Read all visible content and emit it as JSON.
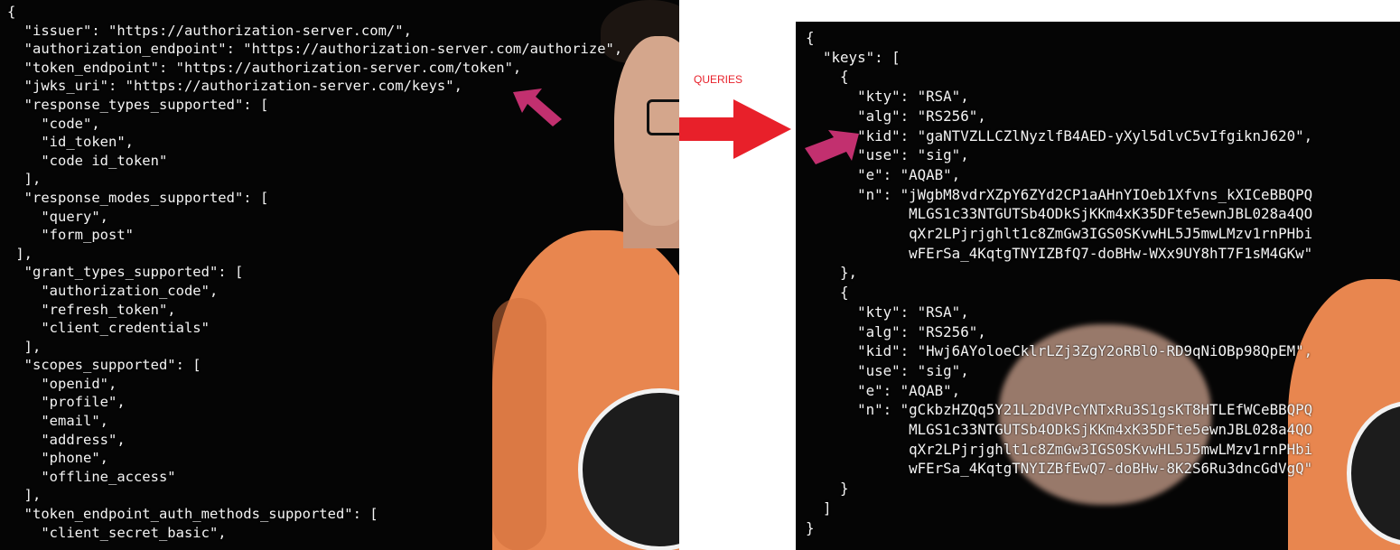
{
  "left_json": {
    "lines": [
      "{",
      "  \"issuer\": \"https://authorization-server.com/\",",
      "  \"authorization_endpoint\": \"https://authorization-server.com/authorize\",",
      "  \"token_endpoint\": \"https://authorization-server.com/token\",",
      "  \"jwks_uri\": \"https://authorization-server.com/keys\",",
      "  \"response_types_supported\": [",
      "    \"code\",",
      "    \"id_token\",",
      "    \"code id_token\"",
      "  ],",
      "  \"response_modes_supported\": [",
      "    \"query\",",
      "    \"form_post\"",
      " ],",
      "  \"grant_types_supported\": [",
      "    \"authorization_code\",",
      "    \"refresh_token\",",
      "    \"client_credentials\"",
      "  ],",
      "  \"scopes_supported\": [",
      "    \"openid\",",
      "    \"profile\",",
      "    \"email\",",
      "    \"address\",",
      "    \"phone\",",
      "    \"offline_access\"",
      "  ],",
      "  \"token_endpoint_auth_methods_supported\": [",
      "    \"client_secret_basic\","
    ]
  },
  "connector": {
    "label": "QUERIES",
    "arrow_color": "#e8202a",
    "pointer_color": "#c2306f"
  },
  "right_json": {
    "lines": [
      "{",
      "  \"keys\": [",
      "    {",
      "      \"kty\": \"RSA\",",
      "      \"alg\": \"RS256\",",
      "      \"kid\": \"gaNTVZLLCZlNyzlfB4AED-yXyl5dlvC5vIfgiknJ620\",",
      "      \"use\": \"sig\",",
      "      \"e\": \"AQAB\",",
      "      \"n\": \"jWgbM8vdrXZpY6ZYd2CP1aAHnYIOeb1Xfvns_kXICeBBQPQ",
      "            MLGS1c33NTGUTSb4ODkSjKKm4xK35DFte5ewnJBL028a4QO",
      "            qXr2LPjrjghlt1c8ZmGw3IGS0SKvwHL5J5mwLMzv1rnPHbi",
      "            wFErSa_4KqtgTNYIZBfQ7-doBHw-WXx9UY8hT7F1sM4GKw\"",
      "    },",
      "    {",
      "      \"kty\": \"RSA\",",
      "      \"alg\": \"RS256\",",
      "      \"kid\": \"Hwj6AYoloeCklrLZj3ZgY2oRBl0-RD9qNiOBp98QpEM\",",
      "      \"use\": \"sig\",",
      "      \"e\": \"AQAB\",",
      "      \"n\": \"gCkbzHZQq5Y21L2DdVPcYNTxRu3S1gsKT8HTLEfWCeBBQPQ",
      "            MLGS1c33NTGUTSb4ODkSjKKm4xK35DFte5ewnJBL028a4QO",
      "            qXr2LPjrjghlt1c8ZmGw3IGS0SKvwHL5J5mwLMzv1rnPHbi",
      "            wFErSa_4KqtgTNYIZBfEwQ7-doBHw-8K2S6Ru3dncGdVgQ\"",
      "    }",
      "  ]",
      "}"
    ]
  }
}
